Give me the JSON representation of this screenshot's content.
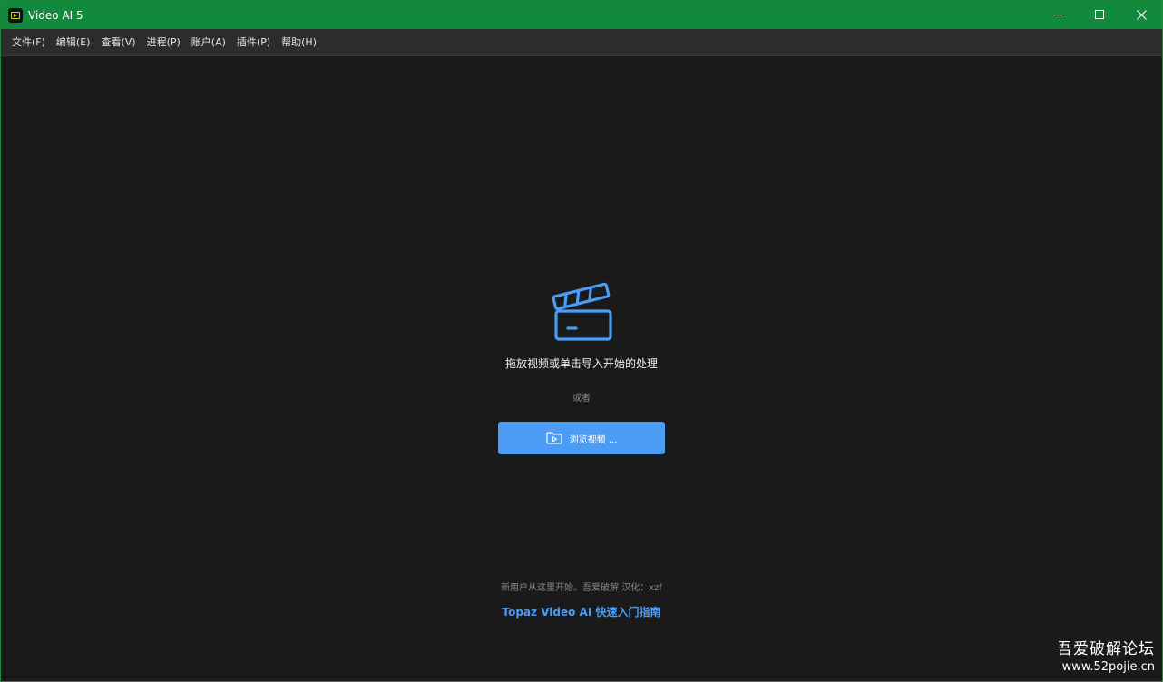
{
  "window": {
    "title": "Video AI 5",
    "controls": [
      "minimize-icon",
      "maximize-icon",
      "close-icon"
    ]
  },
  "menu": {
    "items": [
      {
        "label": "文件(F)"
      },
      {
        "label": "编辑(E)"
      },
      {
        "label": "查看(V)"
      },
      {
        "label": "进程(P)"
      },
      {
        "label": "账户(A)"
      },
      {
        "label": "插件(P)"
      },
      {
        "label": "帮助(H)"
      }
    ]
  },
  "main": {
    "drop_prompt": "拖放视频或单击导入开始的处理",
    "or_label": "或者",
    "browse_button": "浏览视频 ...",
    "footer_note": "新用户从这里开始。吾爱破解 汉化：xzf",
    "guide_link": "Topaz Video AI 快速入门指南"
  },
  "watermark": {
    "line1": "吾爱破解论坛",
    "line2": "www.52pojie.cn"
  },
  "colors": {
    "titlebar": "#118a3e",
    "accent": "#4a9cf5",
    "background": "#1a1a1a"
  }
}
